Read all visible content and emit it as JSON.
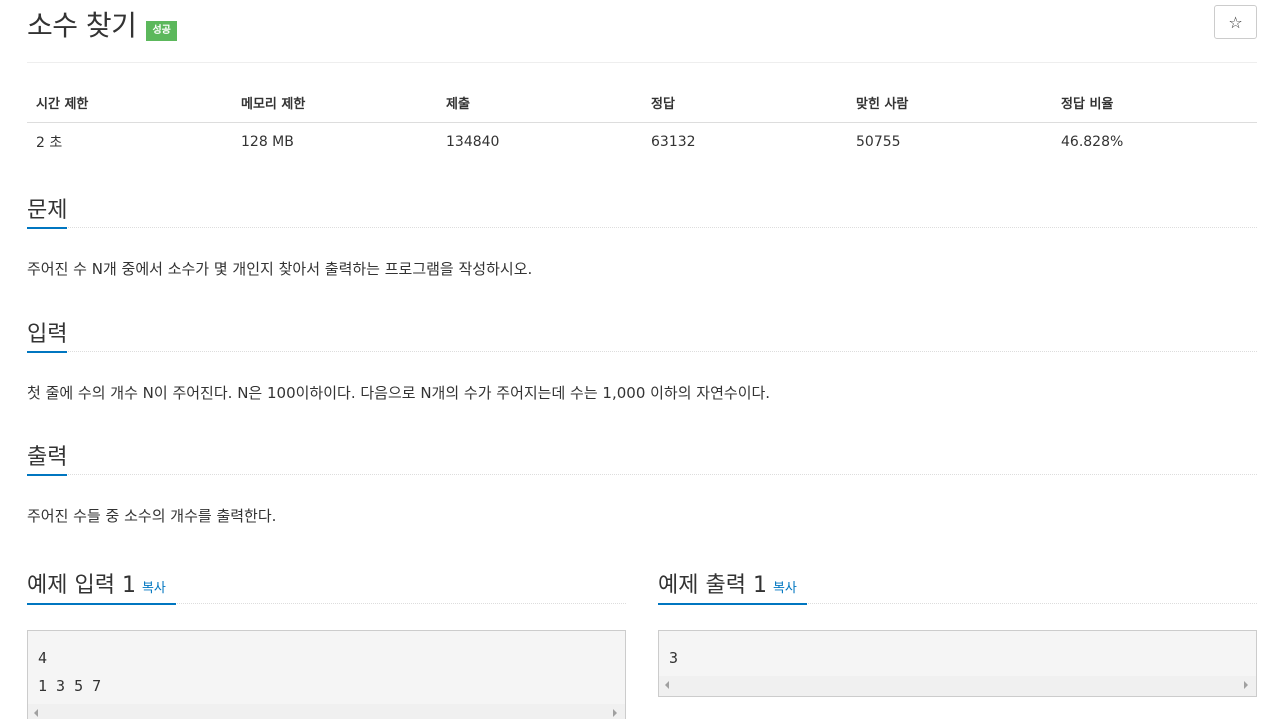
{
  "problem": {
    "title": "소수 찾기",
    "status_badge": "성공",
    "star_icon": "☆"
  },
  "info_table": {
    "headers": [
      "시간 제한",
      "메모리 제한",
      "제출",
      "정답",
      "맞힌 사람",
      "정답 비율"
    ],
    "values": [
      "2 초",
      "128 MB",
      "134840",
      "63132",
      "50755",
      "46.828%"
    ]
  },
  "sections": {
    "description": {
      "title": "문제",
      "text": "주어진 수 N개 중에서 소수가 몇 개인지 찾아서 출력하는 프로그램을 작성하시오."
    },
    "input": {
      "title": "입력",
      "text": "첫 줄에 수의 개수 N이 주어진다. N은 100이하이다. 다음으로 N개의 수가 주어지는데 수는 1,000 이하의 자연수이다."
    },
    "output": {
      "title": "출력",
      "text": "주어진 수들 중 소수의 개수를 출력한다."
    }
  },
  "samples": {
    "input": {
      "title": "예제 입력 1",
      "copy_label": "복사",
      "content": "4\n1 3 5 7"
    },
    "output": {
      "title": "예제 출력 1",
      "copy_label": "복사",
      "content": "3"
    }
  },
  "colors": {
    "accent": "#0076c0",
    "success_badge": "#5cb85c"
  }
}
